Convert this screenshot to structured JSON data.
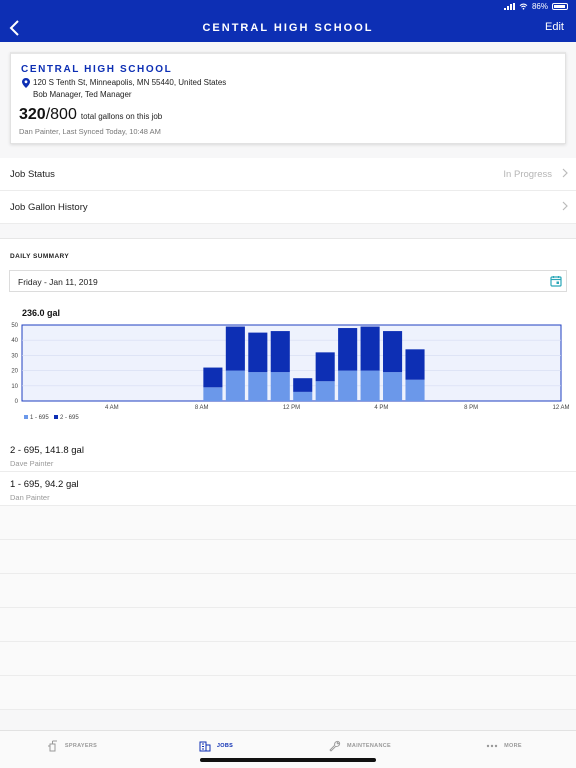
{
  "status_bar": {
    "battery": "86%"
  },
  "nav": {
    "title": "CENTRAL HIGH SCHOOL",
    "edit_label": "Edit"
  },
  "job_card": {
    "name": "CENTRAL HIGH SCHOOL",
    "address": "120 S Tenth St, Minneapolis, MN 55440, United States",
    "managers": "Bob Manager, Ted Manager",
    "gallons_current": "320",
    "gallons_separator": "/",
    "gallons_total": "800",
    "gallons_label": "total gallons on this job",
    "sync_line": "Dan Painter, Last Synced Today, 10:48 AM"
  },
  "rows": [
    {
      "label": "Job Status",
      "value": "In Progress"
    },
    {
      "label": "Job Gallon History",
      "value": ""
    }
  ],
  "daily_summary": {
    "title": "DAILY SUMMARY",
    "date": "Friday - Jan 11, 2019",
    "total": "236.0 gal"
  },
  "chart_data": {
    "type": "bar",
    "stacked": true,
    "categories": [
      "0",
      "1",
      "2",
      "3",
      "4",
      "5",
      "6",
      "7",
      "8",
      "9",
      "10",
      "11",
      "12",
      "13",
      "14",
      "15",
      "16",
      "17",
      "18",
      "19",
      "20",
      "21",
      "22",
      "23"
    ],
    "series": [
      {
        "name": "1 - 695",
        "color": "#6b98ea",
        "values": [
          0,
          0,
          0,
          0,
          0,
          0,
          0,
          0,
          9,
          20,
          19,
          19,
          6,
          13,
          20,
          20,
          19,
          14,
          0,
          0,
          0,
          0,
          0,
          0
        ]
      },
      {
        "name": "2 - 695",
        "color": "#0d2fb4",
        "values": [
          0,
          0,
          0,
          0,
          0,
          0,
          0,
          0,
          13,
          29,
          26,
          27,
          9,
          19,
          28,
          29,
          27,
          20,
          0,
          0,
          0,
          0,
          0,
          0
        ]
      }
    ],
    "x_tick_labels": [
      {
        "hour": 4,
        "label": "4 AM"
      },
      {
        "hour": 8,
        "label": "8 AM"
      },
      {
        "hour": 12,
        "label": "12 PM"
      },
      {
        "hour": 16,
        "label": "4 PM"
      },
      {
        "hour": 20,
        "label": "8 PM"
      },
      {
        "hour": 24,
        "label": "12 AM"
      }
    ],
    "y_ticks": [
      0,
      10,
      20,
      30,
      40,
      50
    ],
    "ylim": [
      0,
      50
    ],
    "grid": true,
    "legend": "bottom-left"
  },
  "entries": [
    {
      "title": "2 - 695, 141.8 gal",
      "sub": "Dave Painter"
    },
    {
      "title": "1 - 695, 94.2 gal",
      "sub": "Dan Painter"
    }
  ],
  "tabs": [
    {
      "label": "SPRAYERS",
      "icon": "sprayer-icon",
      "active": false
    },
    {
      "label": "JOBS",
      "icon": "building-icon",
      "active": true
    },
    {
      "label": "MAINTENANCE",
      "icon": "wrench-icon",
      "active": false
    },
    {
      "label": "MORE",
      "icon": "dots-icon",
      "active": false
    }
  ]
}
